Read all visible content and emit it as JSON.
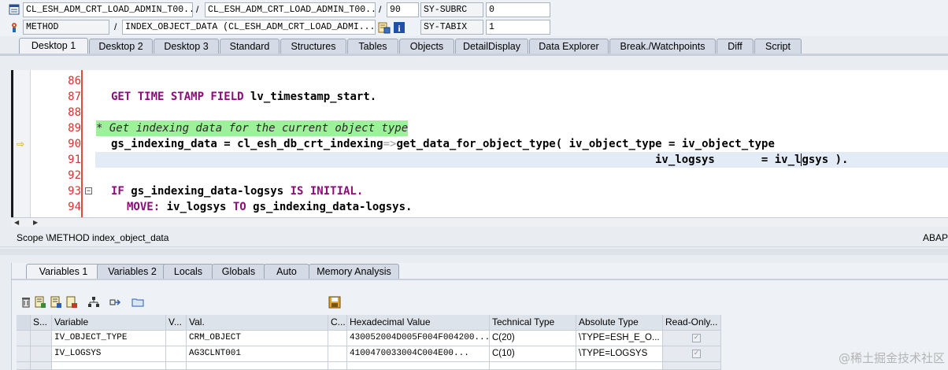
{
  "infobar": {
    "row1": {
      "program": "CL_ESH_ADM_CRT_LOAD_ADMIN_T00...",
      "sep1": "/",
      "include": "CL_ESH_ADM_CRT_LOAD_ADMIN_T00...",
      "sep2": "/",
      "line": "90",
      "sysvar": "SY-SUBRC",
      "sysval": "0"
    },
    "row2": {
      "event_type": "METHOD",
      "sep": "/",
      "event": "INDEX_OBJECT_DATA (CL_ESH_ADM_CRT_LOAD_ADMI...",
      "sysvar": "SY-TABIX",
      "sysval": "1"
    }
  },
  "desktop_tabs": [
    "Desktop 1",
    "Desktop 2",
    "Desktop 3",
    "Standard",
    "Structures",
    "Tables",
    "Objects",
    "DetailDisplay",
    "Data Explorer",
    "Break./Watchpoints",
    "Diff",
    "Script"
  ],
  "code_lines": [
    {
      "num": "86"
    },
    {
      "num": "87"
    },
    {
      "num": "88"
    },
    {
      "num": "89"
    },
    {
      "num": "90"
    },
    {
      "num": "91"
    },
    {
      "num": "92"
    },
    {
      "num": "93"
    },
    {
      "num": "94"
    }
  ],
  "code_text": {
    "l87a": "GET TIME STAMP FIELD",
    "l87b": " lv_timestamp_start.",
    "l89": "* Get indexing data for the current object type",
    "l90a": "gs_indexing_data = cl_esh_db_crt_indexing",
    "l90b": "=>",
    "l90c": "get_data_for_object_type",
    "l90d": "( iv_object_type = iv_object_type",
    "l91a": "iv_logsys",
    "l91b": "       = iv_l",
    "l91c": "gsys ).",
    "l93a": "IF",
    "l93b": " gs_indexing_data-logsys ",
    "l93c": "IS INITIAL.",
    "l94a": "MOVE:",
    "l94b": " iv_logsys ",
    "l94c": "TO",
    "l94d": " gs_indexing_data-logsys."
  },
  "scope": {
    "text": "Scope \\METHOD index_object_data",
    "right": "ABAP"
  },
  "var_tabs": [
    "Variables 1",
    "Variables 2",
    "Locals",
    "Globals",
    "Auto",
    "Memory Analysis"
  ],
  "toolbar_icons": [
    "delete-icon",
    "save-variables-icon",
    "load-variables-icon",
    "load-layout-icon",
    "hierarchy-icon",
    "expand-icon",
    "folder-icon",
    "save-icon"
  ],
  "grid": {
    "headers": [
      "S...",
      "Variable",
      "V...",
      "Val.",
      "C...",
      "Hexadecimal Value",
      "Technical Type",
      "Absolute Type",
      "Read-Only..."
    ],
    "rows": [
      {
        "variable": "IV_OBJECT_TYPE",
        "value": "CRM_OBJECT",
        "hex": "430052004D005F004F004200...",
        "tech": "C(20)",
        "abs": "\\TYPE=ESH_E_O...",
        "readonly": true
      },
      {
        "variable": "IV_LOGSYS",
        "value": "AG3CLNT001",
        "hex": "4100470033004C004E00...",
        "tech": "C(10)",
        "abs": "\\TYPE=LOGSYS",
        "readonly": true
      }
    ]
  },
  "watermark": "@稀土掘金技术社区"
}
